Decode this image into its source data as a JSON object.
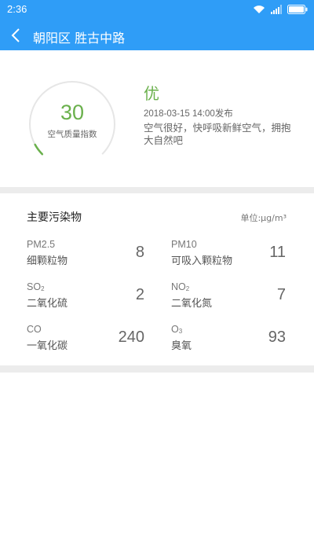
{
  "status_bar": {
    "time": "2:36",
    "icons": [
      "wifi-icon",
      "signal-icon",
      "battery-icon"
    ]
  },
  "header": {
    "title": "朝阳区 胜古中路",
    "back_icon": "back-arrow-icon"
  },
  "aqi": {
    "value": "30",
    "label": "空气质量指数",
    "level": "优",
    "publish_time": "2018-03-15 14:00发布",
    "description": "空气很好，快呼吸新鲜空气，拥抱大自然吧",
    "gauge_fraction": 0.06
  },
  "pollutants": {
    "title": "主要污染物",
    "unit": "单位:μg/m³",
    "items": [
      {
        "name": "PM2.5",
        "desc": "细颗粒物",
        "value": "8"
      },
      {
        "name": "PM10",
        "desc": "可吸入颗粒物",
        "value": "11"
      },
      {
        "name_main": "SO",
        "name_sub": "2",
        "desc": "二氧化硫",
        "value": "2"
      },
      {
        "name_main": "NO",
        "name_sub": "2",
        "desc": "二氧化氮",
        "value": "7"
      },
      {
        "name": "CO",
        "desc": "一氧化碳",
        "value": "240"
      },
      {
        "name_main": "O",
        "name_sub": "3",
        "desc": "臭氧",
        "value": "93"
      }
    ]
  },
  "colors": {
    "header_blue": "#2f9df7",
    "good_green": "#6ab04c",
    "gauge_track": "#e6e6e6",
    "divider": "#ececec"
  }
}
